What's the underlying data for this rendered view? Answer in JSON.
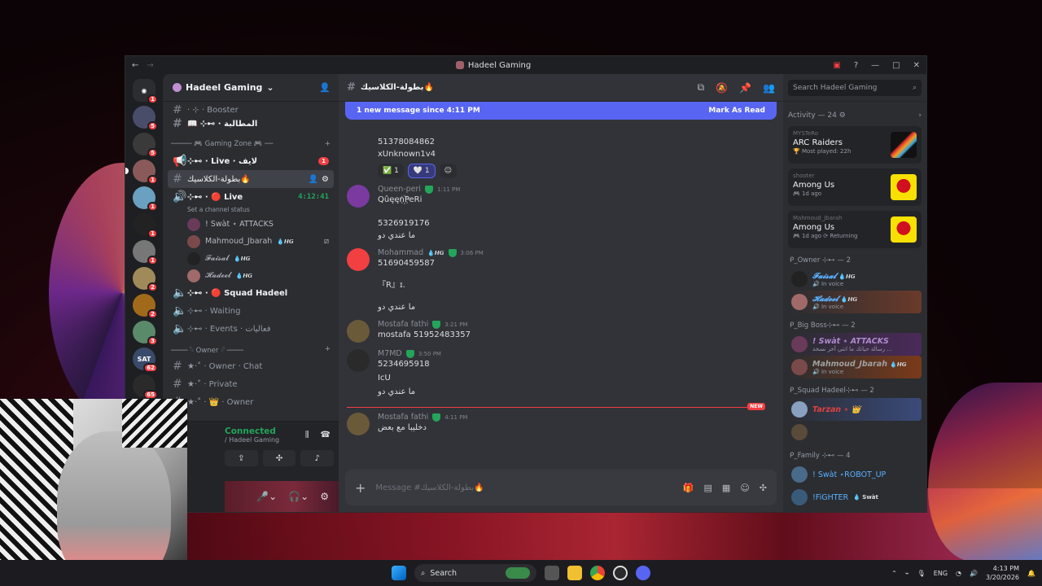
{
  "window": {
    "title": "Hadeel Gaming"
  },
  "server": {
    "name": "Hadeel Gaming"
  },
  "guild_badges": [
    "1",
    "5",
    "5",
    "1",
    "1",
    "1",
    "1",
    "2",
    "2",
    "3",
    "62",
    "65"
  ],
  "channels": {
    "top_partial": "· ⊹ · Booster",
    "ch1": "📖 ⊹⊷ · المطالبة",
    "cat_gaming": "───── 🎮 Gaming Zone 🎮 ──",
    "live": "⊹⊷ · Live · لايف",
    "live_badge": "1",
    "active": "بطولة-الكلاسيك🔥",
    "voice_live": "⊹⊷ · 🔴 Live",
    "voice_timer": "4:12:41",
    "voice_status": "Set a channel status",
    "voice_users": [
      {
        "name": "! Swàt ⋆ ATTACKS",
        "tag": ""
      },
      {
        "name": "Mahmoud_Jbarah",
        "tag": "💧𝙃𝙂"
      },
      {
        "name": "𝓕𝓪𝓲𝓼𝓪𝓵",
        "tag": "💧𝙃𝙂"
      },
      {
        "name": "𝓗𝓪𝓭𝓮𝓮𝓵",
        "tag": "💧𝙃𝙂"
      }
    ],
    "squad": "⊹⊷ · 🔴 Squad Hadeel",
    "waiting": "⊹⊷ · Waiting",
    "events": "⊹⊷ · Events · فعاليات",
    "cat_owner": "──── 𓆩 Owner 𓆪 ────",
    "owner_chat": "★·˚ · Owner · Chat",
    "private": "★·˚ · Private",
    "owner": "★·˚ · 👑 · Owner"
  },
  "rtc": {
    "status": "Connected",
    "sub": "/ Hadeel Gaming"
  },
  "header": {
    "channel": "بطولة-الكلاسيك🔥"
  },
  "banner": {
    "text": "1 new message since 4:11 PM",
    "action": "Mark As Read"
  },
  "messages": {
    "m0_l1": "51378084862",
    "m0_l2": "xUnknown1v4",
    "r1": "✅ 1",
    "r2": "🤍 1",
    "m1": {
      "name": "Queen-peri",
      "time": "1:11 PM",
      "l1": "Qûęęn꙰PeRi",
      "l2": "5326919176",
      "l3": "ما عندي دو"
    },
    "m2": {
      "name": "Mohammad",
      "tag": "💧𝙃𝙂",
      "time": "3:06 PM",
      "l1": "51690459587",
      "l2": "『R』ɪ.",
      "l3": "ما عندي دو"
    },
    "m3": {
      "name": "Mostafa fathi",
      "time": "3:21 PM",
      "l1": "mostafa 51952483357"
    },
    "m4": {
      "name": "M7MD",
      "time": "3:50 PM",
      "l1": "5234695918",
      "l2": "IcU",
      "l3": "ما عندي دو"
    },
    "new_label": "NEW",
    "m5": {
      "name": "Mostafa fathi",
      "time": "4:11 PM",
      "l1": "دخليبا مع بعض"
    }
  },
  "composer": {
    "placeholder": "Message #بطولة-الكلاسيك🔥"
  },
  "members": {
    "search": "Search Hadeel Gaming",
    "activity": "Activity — 24 ⚙",
    "cards": [
      {
        "who": "MYSTeRo",
        "game": "ARC Raiders",
        "meta": "🏆 Most played: 22h"
      },
      {
        "who": "shooter",
        "game": "Among Us",
        "meta": "🎮 1d ago"
      },
      {
        "who": "Mahmoud_Jbarah",
        "game": "Among Us",
        "meta": "🎮 1d ago  ⟳ Returning"
      }
    ],
    "g_owner": "ᑭ_Owner ⊹⊷ — 2",
    "owner1": "𝓕𝓪𝓲𝓼𝓪𝓵",
    "owner1_tag": "💧𝙃𝙂",
    "owner1_s": "🔊 In voice",
    "owner2": "𝓗𝓪𝓭𝓮𝓮𝓵",
    "owner2_tag": "💧𝙃𝙂",
    "owner2_s": "🔊 In voice",
    "g_boss": "ᑭ_Big Boss⊹⊷ — 2",
    "boss1": "! Swàt ⋆ ATTACKS",
    "boss1_s": "رسالة حياتك ما انتي آخر نسخة ...",
    "boss2": "Mahmoud_Jbarah",
    "boss2_tag": "💧𝙃𝙂",
    "boss2_s": "🔊 In voice",
    "g_squad": "ᑭ_Squad Hadeel⊹⊷ — 2",
    "squad1": "Tarzan ⋆ 👑",
    "g_family": "ᑭ_Family ⊹⊷ — 4",
    "fam1": "! Swàt ⋆ROBOT_UP",
    "fam2": "!FiGHTER",
    "fam2_tag": "💧 Swàt"
  },
  "taskbar": {
    "search": "Search",
    "lang": "ENG",
    "time": "4:13 PM",
    "date": "3/20/2026"
  },
  "colors": {
    "blurple": "#5865f2",
    "green": "#23a55a",
    "red": "#f23f42"
  }
}
